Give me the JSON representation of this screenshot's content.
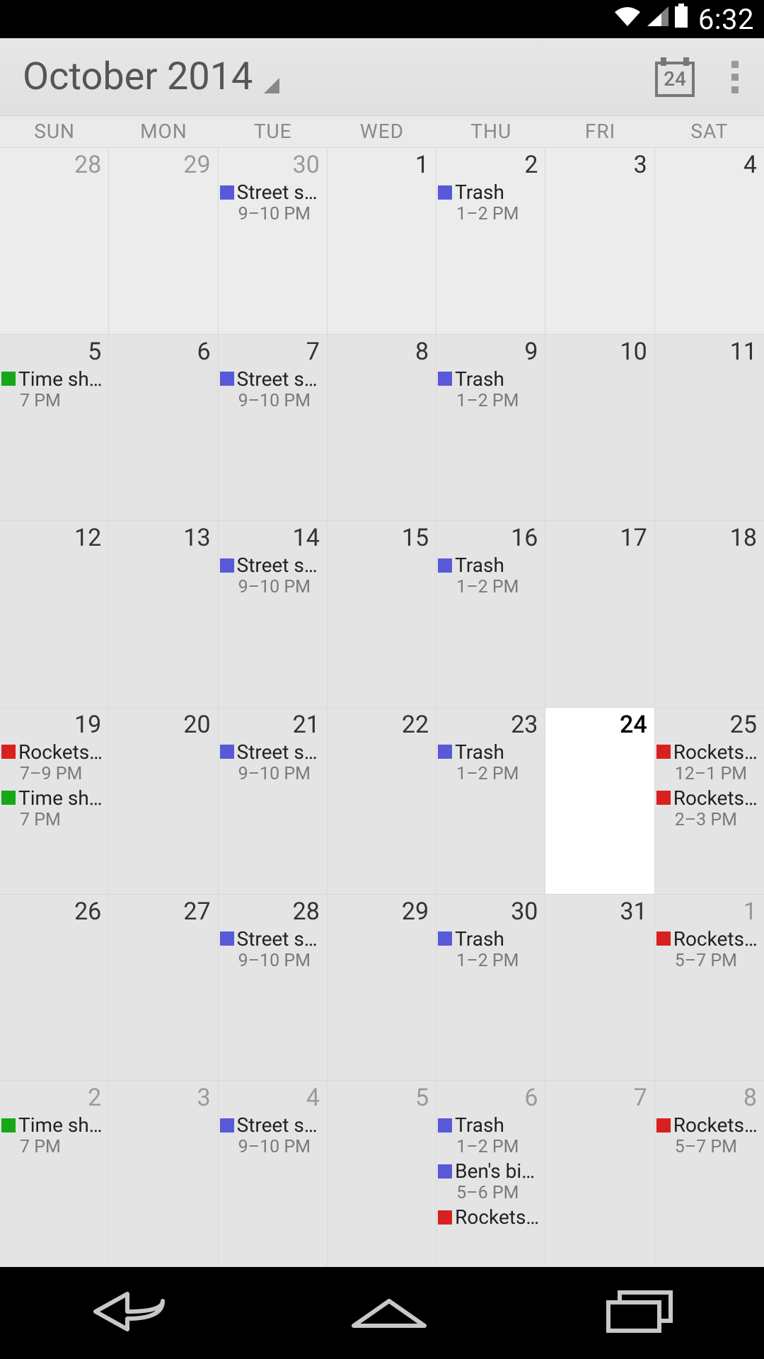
{
  "status": {
    "time": "6:32"
  },
  "header": {
    "title": "October 2014",
    "today_badge": "24"
  },
  "dow": [
    "SUN",
    "MON",
    "TUE",
    "WED",
    "THU",
    "FRI",
    "SAT"
  ],
  "colors": {
    "purple": "#5858d8",
    "green": "#17a817",
    "red": "#d92020"
  },
  "weeks": [
    [
      {
        "n": "28",
        "other": true,
        "events": []
      },
      {
        "n": "29",
        "other": true,
        "events": []
      },
      {
        "n": "30",
        "other": true,
        "events": [
          {
            "c": "purple",
            "t": "Street s…",
            "tm": "9–10 PM"
          }
        ]
      },
      {
        "n": "1",
        "events": []
      },
      {
        "n": "2",
        "events": [
          {
            "c": "purple",
            "t": "Trash",
            "tm": "1–2 PM"
          }
        ]
      },
      {
        "n": "3",
        "events": []
      },
      {
        "n": "4",
        "events": []
      }
    ],
    [
      {
        "n": "5",
        "events": [
          {
            "c": "green",
            "t": "Time sh…",
            "tm": "7 PM"
          }
        ]
      },
      {
        "n": "6",
        "events": []
      },
      {
        "n": "7",
        "events": [
          {
            "c": "purple",
            "t": "Street s…",
            "tm": "9–10 PM"
          }
        ]
      },
      {
        "n": "8",
        "events": []
      },
      {
        "n": "9",
        "events": [
          {
            "c": "purple",
            "t": "Trash",
            "tm": "1–2 PM"
          }
        ]
      },
      {
        "n": "10",
        "events": []
      },
      {
        "n": "11",
        "events": []
      }
    ],
    [
      {
        "n": "12",
        "events": []
      },
      {
        "n": "13",
        "events": []
      },
      {
        "n": "14",
        "events": [
          {
            "c": "purple",
            "t": "Street s…",
            "tm": "9–10 PM"
          }
        ]
      },
      {
        "n": "15",
        "events": []
      },
      {
        "n": "16",
        "events": [
          {
            "c": "purple",
            "t": "Trash",
            "tm": "1–2 PM"
          }
        ]
      },
      {
        "n": "17",
        "events": []
      },
      {
        "n": "18",
        "events": []
      }
    ],
    [
      {
        "n": "19",
        "events": [
          {
            "c": "red",
            "t": "Rockets…",
            "tm": "7–9 PM"
          },
          {
            "c": "green",
            "t": "Time sh…",
            "tm": "7 PM"
          }
        ]
      },
      {
        "n": "20",
        "events": []
      },
      {
        "n": "21",
        "events": [
          {
            "c": "purple",
            "t": "Street s…",
            "tm": "9–10 PM"
          }
        ]
      },
      {
        "n": "22",
        "events": []
      },
      {
        "n": "23",
        "events": [
          {
            "c": "purple",
            "t": "Trash",
            "tm": "1–2 PM"
          }
        ]
      },
      {
        "n": "24",
        "today": true,
        "events": []
      },
      {
        "n": "25",
        "events": [
          {
            "c": "red",
            "t": "Rockets…",
            "tm": "12–1 PM"
          },
          {
            "c": "red",
            "t": "Rockets…",
            "tm": "2–3 PM"
          }
        ]
      }
    ],
    [
      {
        "n": "26",
        "events": []
      },
      {
        "n": "27",
        "events": []
      },
      {
        "n": "28",
        "events": [
          {
            "c": "purple",
            "t": "Street s…",
            "tm": "9–10 PM"
          }
        ]
      },
      {
        "n": "29",
        "events": []
      },
      {
        "n": "30",
        "events": [
          {
            "c": "purple",
            "t": "Trash",
            "tm": "1–2 PM"
          }
        ]
      },
      {
        "n": "31",
        "events": []
      },
      {
        "n": "1",
        "other": true,
        "events": [
          {
            "c": "red",
            "t": "Rockets…",
            "tm": "5–7 PM"
          }
        ]
      }
    ],
    [
      {
        "n": "2",
        "other": true,
        "events": [
          {
            "c": "green",
            "t": "Time sh…",
            "tm": "7 PM"
          }
        ]
      },
      {
        "n": "3",
        "other": true,
        "events": []
      },
      {
        "n": "4",
        "other": true,
        "events": [
          {
            "c": "purple",
            "t": "Street s…",
            "tm": "9–10 PM"
          }
        ]
      },
      {
        "n": "5",
        "other": true,
        "events": []
      },
      {
        "n": "6",
        "other": true,
        "events": [
          {
            "c": "purple",
            "t": "Trash",
            "tm": "1–2 PM"
          },
          {
            "c": "purple",
            "t": "Ben's bi…",
            "tm": "5–6 PM"
          },
          {
            "c": "red",
            "t": "Rockets…",
            "tm": ""
          }
        ]
      },
      {
        "n": "7",
        "other": true,
        "events": []
      },
      {
        "n": "8",
        "other": true,
        "events": [
          {
            "c": "red",
            "t": "Rockets…",
            "tm": "5–7 PM"
          }
        ]
      }
    ]
  ]
}
